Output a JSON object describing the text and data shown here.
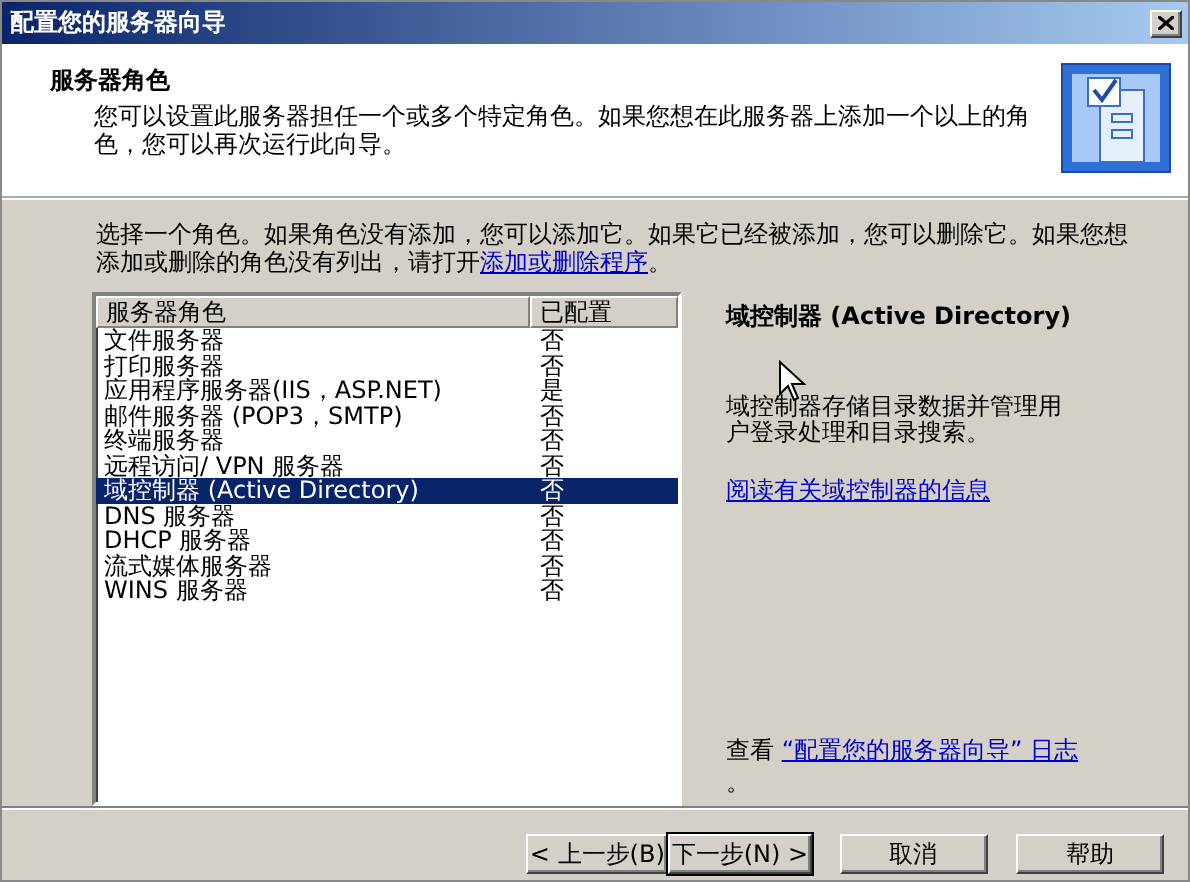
{
  "window": {
    "title": "配置您的服务器向导"
  },
  "header": {
    "title": "服务器角色",
    "description": "您可以设置此服务器担任一个或多个特定角色。如果您想在此服务器上添加一个以上的角色，您可以再次运行此向导。"
  },
  "instruction": {
    "text": "选择一个角色。如果角色没有添加，您可以添加它。如果它已经被添加，您可以删除它。如果您想添加或删除的角色没有列出，请打开",
    "link": "添加或删除程序",
    "text_after": "。"
  },
  "table": {
    "columns": [
      "服务器角色",
      "已配置"
    ],
    "rows": [
      {
        "role": "文件服务器",
        "configured": "否",
        "selected": false
      },
      {
        "role": "打印服务器",
        "configured": "否",
        "selected": false
      },
      {
        "role": "应用程序服务器(IIS，ASP.NET)",
        "configured": "是",
        "selected": false
      },
      {
        "role": "邮件服务器 (POP3，SMTP)",
        "configured": "否",
        "selected": false
      },
      {
        "role": "终端服务器",
        "configured": "否",
        "selected": false
      },
      {
        "role": "远程访问/ VPN 服务器",
        "configured": "否",
        "selected": false
      },
      {
        "role": "域控制器 (Active Directory)",
        "configured": "否",
        "selected": true
      },
      {
        "role": "DNS 服务器",
        "configured": "否",
        "selected": false
      },
      {
        "role": "DHCP 服务器",
        "configured": "否",
        "selected": false
      },
      {
        "role": "流式媒体服务器",
        "configured": "否",
        "selected": false
      },
      {
        "role": "WINS 服务器",
        "configured": "否",
        "selected": false
      }
    ]
  },
  "details": {
    "title": "域控制器 (Active Directory)",
    "description": "域控制器存储目录数据并管理用户登录处理和目录搜索。",
    "link": "阅读有关域控制器的信息"
  },
  "log": {
    "text": "查看 ",
    "link": "“配置您的服务器向导” 日志",
    "text_after": "。"
  },
  "buttons": [
    {
      "label": "< 上一步(B)",
      "default": false
    },
    {
      "label": "下一步(N) >",
      "default": true
    },
    {
      "label": "取消",
      "default": false
    },
    {
      "label": "帮助",
      "default": false
    }
  ]
}
